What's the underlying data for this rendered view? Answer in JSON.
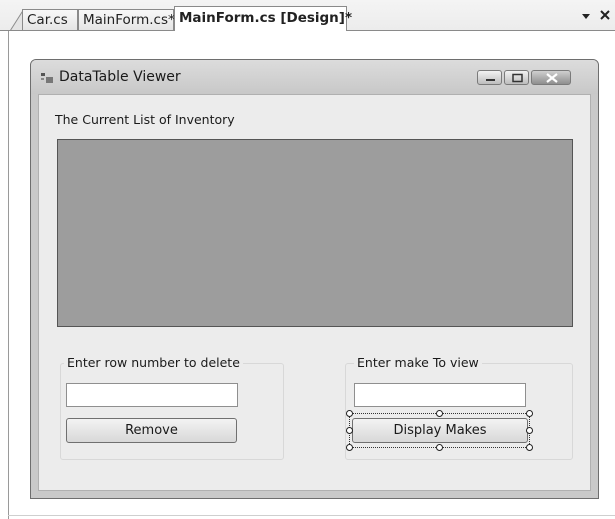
{
  "ide": {
    "tabs": [
      {
        "label": "Car.cs"
      },
      {
        "label": "MainForm.cs*"
      },
      {
        "label": "MainForm.cs [Design]*",
        "active": true
      }
    ],
    "dropdown_icon": "triangle-down",
    "close_icon": "x"
  },
  "form": {
    "title": "DataTable Viewer",
    "inventory_label": "The Current List of Inventory",
    "delete_group": {
      "legend": "Enter row number to delete",
      "input_value": "",
      "button_label": "Remove"
    },
    "view_group": {
      "legend": "Enter make To view",
      "input_value": "",
      "button_label": "Display Makes",
      "selected": true
    }
  },
  "colors": {
    "form_frame": "#c9c9c9",
    "client_area": "#ececec",
    "grid_background": "#9d9d9d"
  }
}
